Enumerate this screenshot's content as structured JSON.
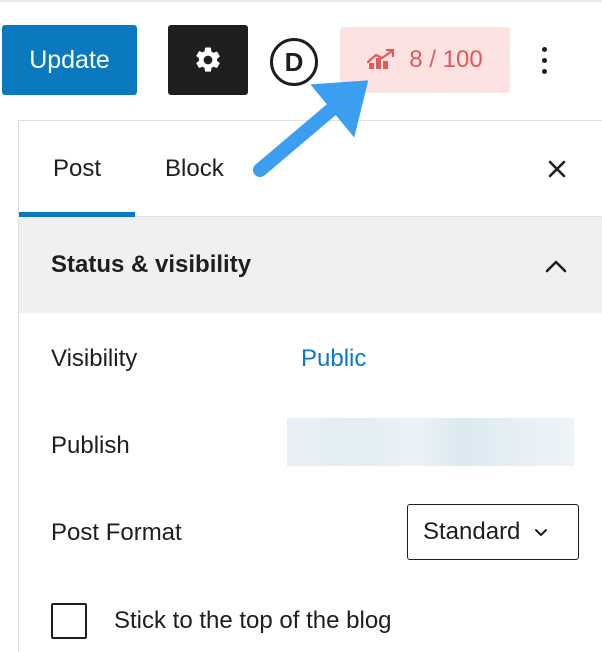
{
  "toolbar": {
    "update_label": "Update",
    "settings_icon": "gear-icon",
    "divi_logo_letter": "D",
    "score_badge": {
      "icon": "chart-icon",
      "text": "8 / 100",
      "color": "#e05a5a",
      "background": "#fde2e2"
    },
    "more_icon": "vertical-ellipsis-icon"
  },
  "sidebar": {
    "tabs": [
      {
        "label": "Post",
        "active": true
      },
      {
        "label": "Block",
        "active": false
      }
    ],
    "close_icon": "close-icon",
    "section": {
      "title": "Status & visibility",
      "expanded": true,
      "rows": {
        "visibility": {
          "label": "Visibility",
          "value": "Public"
        },
        "publish": {
          "label": "Publish",
          "value": ""
        },
        "post_format": {
          "label": "Post Format",
          "value": "Standard"
        }
      },
      "sticky": {
        "label": "Stick to the top of the blog",
        "checked": false
      }
    }
  },
  "colors": {
    "accent": "#0b79bf",
    "dark": "#1e1e1e",
    "annotation_arrow": "#3b9ef0"
  }
}
